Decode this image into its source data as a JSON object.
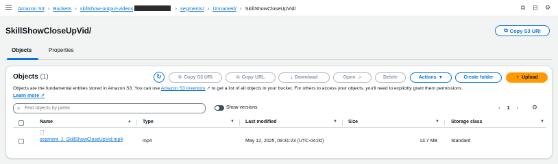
{
  "breadcrumbs": {
    "items": [
      "Amazon S3",
      "Buckets",
      "skillshow-output-videos",
      "segments/",
      "Unnamed/"
    ],
    "current": "SkillShowCloseUpVid/"
  },
  "header": {
    "title": "SkillShowCloseUpVid/",
    "copy_uri_label": "Copy S3 URI"
  },
  "tabs": [
    {
      "label": "Objects",
      "active": true
    },
    {
      "label": "Properties",
      "active": false
    }
  ],
  "objects_panel": {
    "title": "Objects",
    "count": "(1)",
    "buttons": {
      "copy_s3_uri": "Copy S3 URI",
      "copy_url": "Copy URL",
      "download": "Download",
      "open": "Open",
      "delete": "Delete",
      "actions": "Actions",
      "create_folder": "Create folder",
      "upload": "Upload"
    },
    "description_start": "Objects are the fundamental entities stored in Amazon S3. You can use ",
    "inventory_link": "Amazon S3 inventory",
    "description_end": " to get a list of all objects in your bucket. For others to access your objects, you'll need to explicitly grant them permissions.",
    "learn_more": "Learn more",
    "search_placeholder": "Find objects by prefix",
    "show_versions": "Show versions",
    "page_number": "1"
  },
  "table": {
    "columns": [
      "Name",
      "Type",
      "Last modified",
      "Size",
      "Storage class"
    ],
    "rows": [
      {
        "name": "segment_1_SkillShowCloseUpVid.mp4",
        "type": "mp4",
        "last_modified": "May 12, 2025, 09:31:23 (UTC-04:00)",
        "size": "13.7 MB",
        "storage_class": "Standard"
      }
    ]
  },
  "colors": {
    "link": "#0972d3",
    "upload_bg": "#ff9900",
    "page_bg": "#f2f3f3"
  },
  "icons": [
    "menu-icon",
    "notifications-icon",
    "external-link-icon",
    "settings-icon",
    "copy-icon",
    "refresh-icon",
    "download-icon",
    "search-icon",
    "upload-icon",
    "file-icon"
  ]
}
